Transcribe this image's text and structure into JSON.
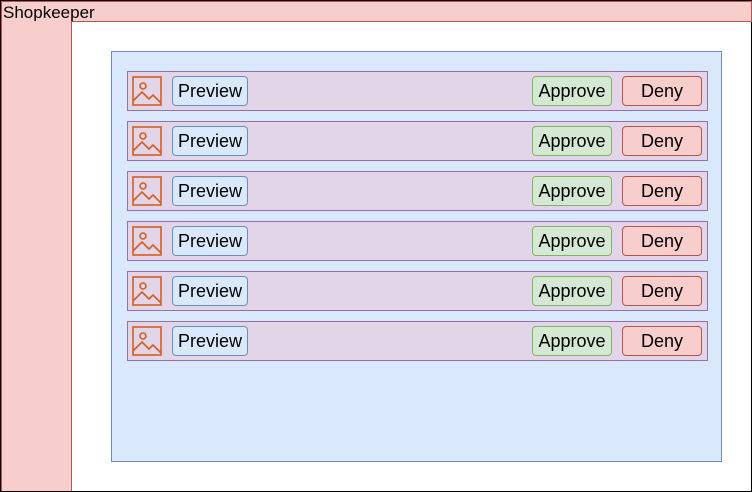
{
  "app": {
    "title": "Shopkeeper"
  },
  "rows": [
    {
      "preview_label": "Preview",
      "approve_label": "Approve",
      "deny_label": "Deny"
    },
    {
      "preview_label": "Preview",
      "approve_label": "Approve",
      "deny_label": "Deny"
    },
    {
      "preview_label": "Preview",
      "approve_label": "Approve",
      "deny_label": "Deny"
    },
    {
      "preview_label": "Preview",
      "approve_label": "Approve",
      "deny_label": "Deny"
    },
    {
      "preview_label": "Preview",
      "approve_label": "Approve",
      "deny_label": "Deny"
    },
    {
      "preview_label": "Preview",
      "approve_label": "Approve",
      "deny_label": "Deny"
    }
  ],
  "icons": {
    "thumbnail": "image-icon"
  },
  "colors": {
    "header_fill": "#f8cecc",
    "header_stroke": "#b85450",
    "panel_fill": "#dae8fc",
    "panel_stroke": "#6c8ebf",
    "row_fill": "#e1d5e7",
    "row_stroke": "#9673a6",
    "approve_fill": "#d5e8d4",
    "approve_stroke": "#82b366",
    "deny_fill": "#f8cecc",
    "deny_stroke": "#b85450",
    "icon_stroke": "#d35f23"
  }
}
